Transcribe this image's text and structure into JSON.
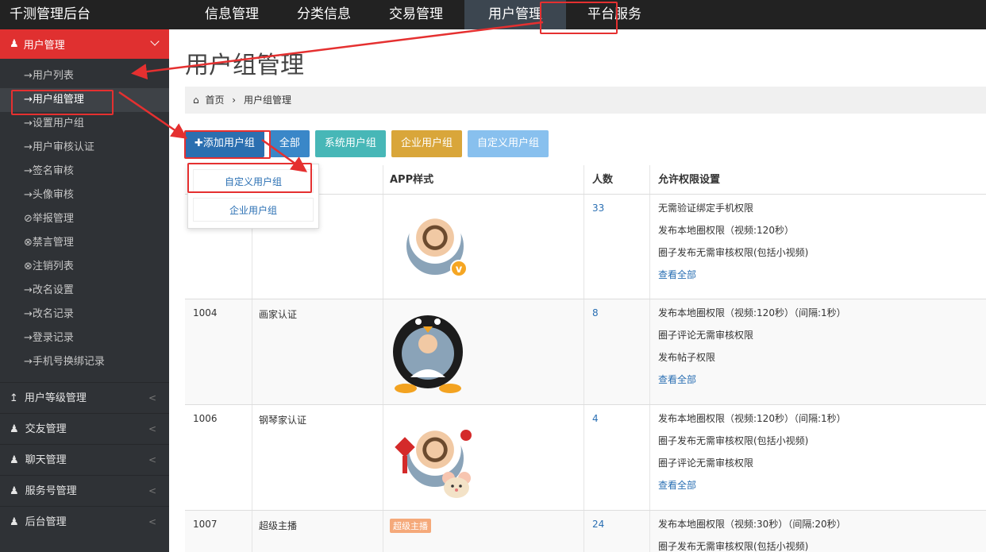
{
  "brand": "千测管理后台",
  "topnav": [
    "信息管理",
    "分类信息",
    "交易管理",
    "用户管理",
    "平台服务"
  ],
  "sidebar": {
    "head": "用户管理",
    "sub_items": [
      "→用户列表",
      "→用户组管理",
      "→设置用户组",
      "→用户审核认证",
      "→签名审核",
      "→头像审核",
      "⊘举报管理",
      "⊗禁言管理",
      "⊗注销列表",
      "→改名设置",
      "→改名记录",
      "→登录记录",
      "→手机号换绑记录"
    ],
    "groups": [
      "用户等级管理",
      "交友管理",
      "聊天管理",
      "服务号管理",
      "后台管理"
    ]
  },
  "page_title": "用户组管理",
  "breadcrumb": {
    "home": "首页",
    "sep": "›",
    "current": "用户组管理"
  },
  "buttons": {
    "add": "✚添加用户组",
    "all": "全部",
    "sys": "系统用户组",
    "ent": "企业用户组",
    "custom": "自定义用户组"
  },
  "dropdown": [
    "自定义用户组",
    "企业用户组"
  ],
  "table": {
    "headers": {
      "app": "APP样式",
      "count": "人数",
      "perm": "允许权限设置"
    },
    "rows": [
      {
        "id": "",
        "name": "",
        "count": "33",
        "perms": [
          "无需验证绑定手机权限",
          "发布本地圈权限（视频:120秒）",
          "圈子发布无需审核权限(包括小视频)",
          "查看全部"
        ]
      },
      {
        "id": "1004",
        "name": "画家认证",
        "count": "8",
        "perms": [
          "发布本地圈权限（视频:120秒）（间隔:1秒）",
          "圈子评论无需审核权限",
          "发布帖子权限",
          "查看全部"
        ]
      },
      {
        "id": "1006",
        "name": "钢琴家认证",
        "count": "4",
        "perms": [
          "发布本地圈权限（视频:120秒）（间隔:1秒）",
          "圈子发布无需审核权限(包括小视频)",
          "圈子评论无需审核权限",
          "查看全部"
        ]
      },
      {
        "id": "1007",
        "name": "超级主播",
        "tag": "超级主播",
        "count": "24",
        "perms": [
          "发布本地圈权限（视频:30秒）（间隔:20秒）",
          "圈子发布无需审核权限(包括小视频)"
        ]
      }
    ]
  },
  "badge_v": "v",
  "colors": {
    "topbar": "#222222",
    "sidebar": "#2f3236",
    "active_red": "#e03030",
    "annotation": "#e53030"
  }
}
